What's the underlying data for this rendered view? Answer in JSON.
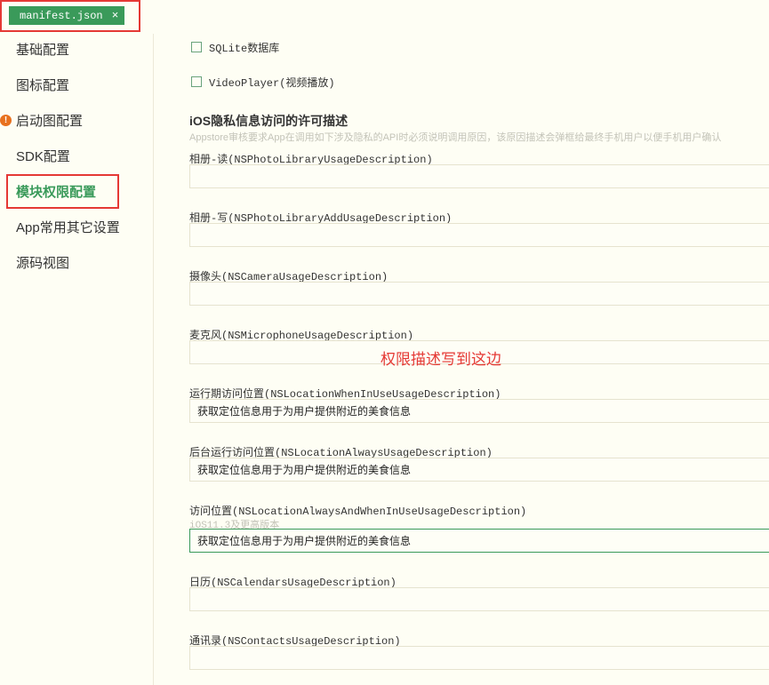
{
  "tab": {
    "label": "manifest.json",
    "close": "×"
  },
  "sidebar": {
    "items": [
      {
        "label": "基础配置"
      },
      {
        "label": "图标配置"
      },
      {
        "label": "启动图配置"
      },
      {
        "label": "SDK配置"
      },
      {
        "label": "模块权限配置"
      },
      {
        "label": "App常用其它设置"
      },
      {
        "label": "源码视图"
      }
    ],
    "warning_mark": "!"
  },
  "modules": [
    {
      "label": "SQLite数据库",
      "checked": false
    },
    {
      "label": "VideoPlayer(视频播放)",
      "checked": false
    }
  ],
  "privacy": {
    "title": "iOS隐私信息访问的许可描述",
    "description": "Appstore审核要求App在调用如下涉及隐私的API时必须说明调用原因，该原因描述会弹框给最终手机用户以便手机用户确认",
    "fields": [
      {
        "label": "相册-读(NSPhotoLibraryUsageDescription)",
        "value": ""
      },
      {
        "label": "相册-写(NSPhotoLibraryAddUsageDescription)",
        "value": ""
      },
      {
        "label": "摄像头(NSCameraUsageDescription)",
        "value": ""
      },
      {
        "label": "麦克风(NSMicrophoneUsageDescription)",
        "value": ""
      },
      {
        "label": "运行期访问位置(NSLocationWhenInUseUsageDescription)",
        "value": "获取定位信息用于为用户提供附近的美食信息"
      },
      {
        "label": "后台运行访问位置(NSLocationAlwaysUsageDescription)",
        "value": "获取定位信息用于为用户提供附近的美食信息"
      },
      {
        "label": "访问位置(NSLocationAlwaysAndWhenInUseUsageDescription)",
        "sublabel": "iOS11.3及更高版本",
        "value": "获取定位信息用于为用户提供附近的美食信息"
      },
      {
        "label": "日历(NSCalendarsUsageDescription)",
        "value": ""
      },
      {
        "label": "通讯录(NSContactsUsageDescription)",
        "value": ""
      }
    ]
  },
  "annotation": "权限描述写到这边",
  "colors": {
    "accent": "#3a9a5a",
    "annotation_red": "#e53935",
    "warning_orange": "#e8711e"
  }
}
